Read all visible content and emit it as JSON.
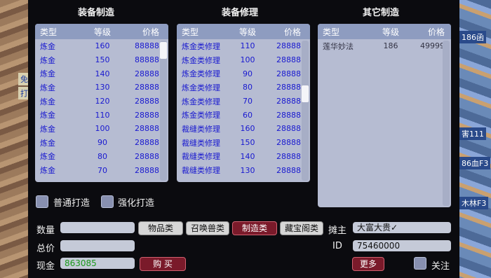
{
  "right_edge_labels": [
    "186函",
    "害111",
    "86血F3",
    "木林F3"
  ],
  "left_edge_labels": [
    "免",
    "打"
  ],
  "columns": {
    "craft": {
      "title": "装备制造",
      "headers": [
        "类型",
        "等级",
        "价格"
      ],
      "rows": [
        [
          "炼金",
          "160",
          "88888"
        ],
        [
          "炼金",
          "150",
          "88888"
        ],
        [
          "炼金",
          "140",
          "28888"
        ],
        [
          "炼金",
          "130",
          "28888"
        ],
        [
          "炼金",
          "120",
          "28888"
        ],
        [
          "炼金",
          "110",
          "28888"
        ],
        [
          "炼金",
          "100",
          "28888"
        ],
        [
          "炼金",
          "90",
          "28888"
        ],
        [
          "炼金",
          "80",
          "28888"
        ],
        [
          "炼金",
          "70",
          "28888"
        ]
      ]
    },
    "repair": {
      "title": "装备修理",
      "headers": [
        "类型",
        "等级",
        "价格"
      ],
      "rows": [
        [
          "炼金类修理",
          "110",
          "28888"
        ],
        [
          "炼金类修理",
          "100",
          "28888"
        ],
        [
          "炼金类修理",
          "90",
          "28888"
        ],
        [
          "炼金类修理",
          "80",
          "28888"
        ],
        [
          "炼金类修理",
          "70",
          "28888"
        ],
        [
          "炼金类修理",
          "60",
          "28888"
        ],
        [
          "裁缝类修理",
          "160",
          "28888"
        ],
        [
          "裁缝类修理",
          "150",
          "28888"
        ],
        [
          "裁缝类修理",
          "140",
          "28888"
        ],
        [
          "裁缝类修理",
          "130",
          "28888"
        ]
      ]
    },
    "other": {
      "title": "其它制造",
      "headers": [
        "类型",
        "等级",
        "价格"
      ],
      "rows": [
        [
          "莲华妙法",
          "186",
          "49999"
        ]
      ]
    }
  },
  "options": {
    "normal_craft": "普通打造",
    "enhanced_craft": "强化打造"
  },
  "form": {
    "quantity_label": "数量",
    "total_label": "总价",
    "cash_label": "现金",
    "cash_value": "863085",
    "buy_button": "购 买"
  },
  "category_tabs": [
    "物品类",
    "召唤兽类",
    "制造类",
    "藏宝阁类"
  ],
  "seller": {
    "owner_label": "摊主",
    "owner_value": "大富大贵✓",
    "id_label": "ID",
    "id_value": "75460000",
    "more_button": "更多",
    "follow_label": "关注"
  },
  "colors": {
    "list_bg": "#b6bcd2",
    "list_header": "#8e9cc0",
    "row_text": "#1818d0",
    "active_tab": "#7a1a2a",
    "cash_text": "#1a9a1a"
  }
}
